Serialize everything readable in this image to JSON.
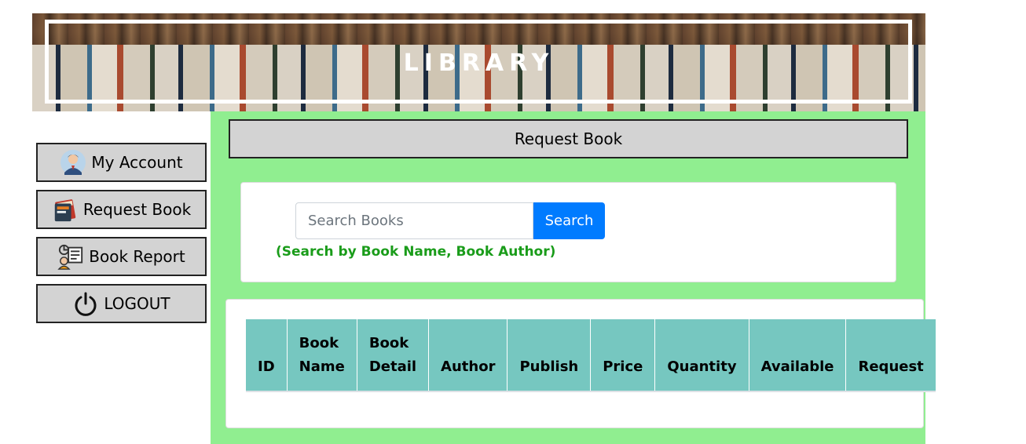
{
  "banner": {
    "title": "LIBRARY"
  },
  "sidebar": {
    "items": [
      {
        "label": "My Account",
        "icon": "user-avatar-icon"
      },
      {
        "label": "Request Book",
        "icon": "book-icon"
      },
      {
        "label": "Book Report",
        "icon": "report-icon"
      },
      {
        "label": "LOGOUT",
        "icon": "power-icon"
      }
    ]
  },
  "main": {
    "header": "Request Book",
    "search": {
      "placeholder": "Search Books",
      "value": "",
      "button_label": "Search",
      "hint": "(Search by Book Name, Book Author)"
    },
    "table": {
      "columns": [
        "ID",
        "Book Name",
        "Book Detail",
        "Author",
        "Publish",
        "Price",
        "Quantity",
        "Available",
        "Request"
      ],
      "rows": []
    }
  },
  "colors": {
    "main_background": "#90ee90",
    "button_gray": "#d3d3d3",
    "search_button": "#007bff",
    "hint_text": "#1a9c1a",
    "table_header": "#76c7c0"
  }
}
